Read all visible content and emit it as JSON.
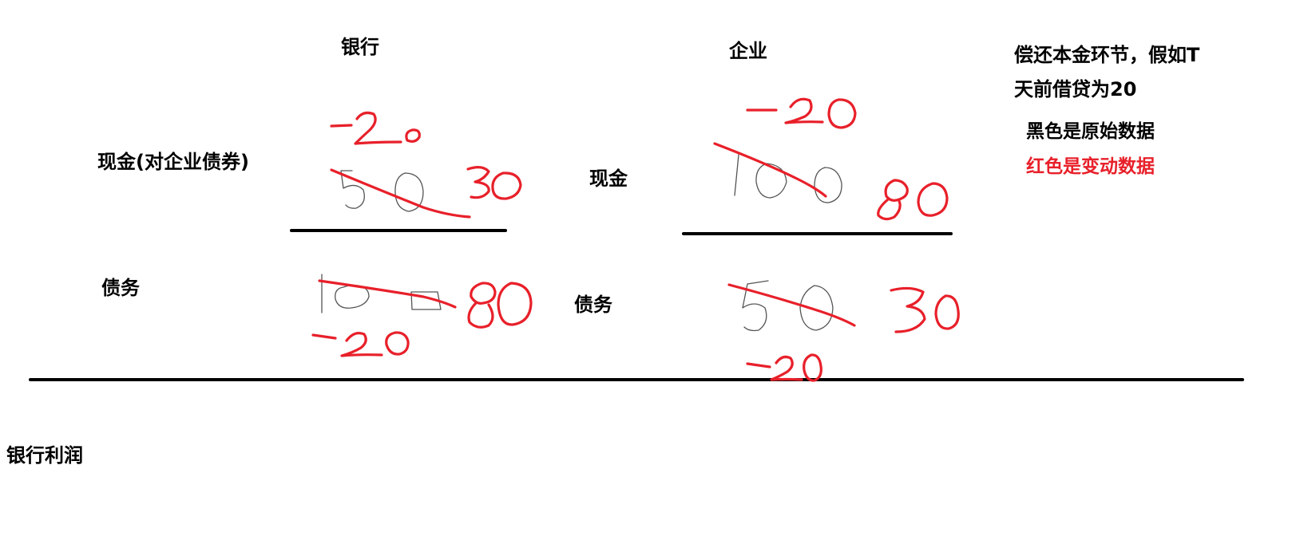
{
  "headers": {
    "bank": "银行",
    "enterprise": "企业"
  },
  "labels": {
    "bank_cash": "现金(对企业债券)",
    "bank_debt": "债务",
    "ent_cash": "现金",
    "ent_debt": "债务",
    "bank_profit": "银行利润"
  },
  "notes": {
    "line1": "偿还本金环节，假如T",
    "line2": "天前借贷为20",
    "legend_black": "黑色是原始数据",
    "legend_red": "红色是变动数据"
  },
  "values": {
    "bank_cash": {
      "original": "50",
      "change": "-20",
      "new": "30"
    },
    "bank_debt": {
      "original": "100",
      "change": "-20",
      "new": "80"
    },
    "ent_cash": {
      "original": "100",
      "change": "-20",
      "new": "80"
    },
    "ent_debt": {
      "original": "50",
      "change": "-20",
      "new": "30"
    }
  },
  "colors": {
    "original": "#555555",
    "change": "#e8202a",
    "rule": "#000000"
  }
}
